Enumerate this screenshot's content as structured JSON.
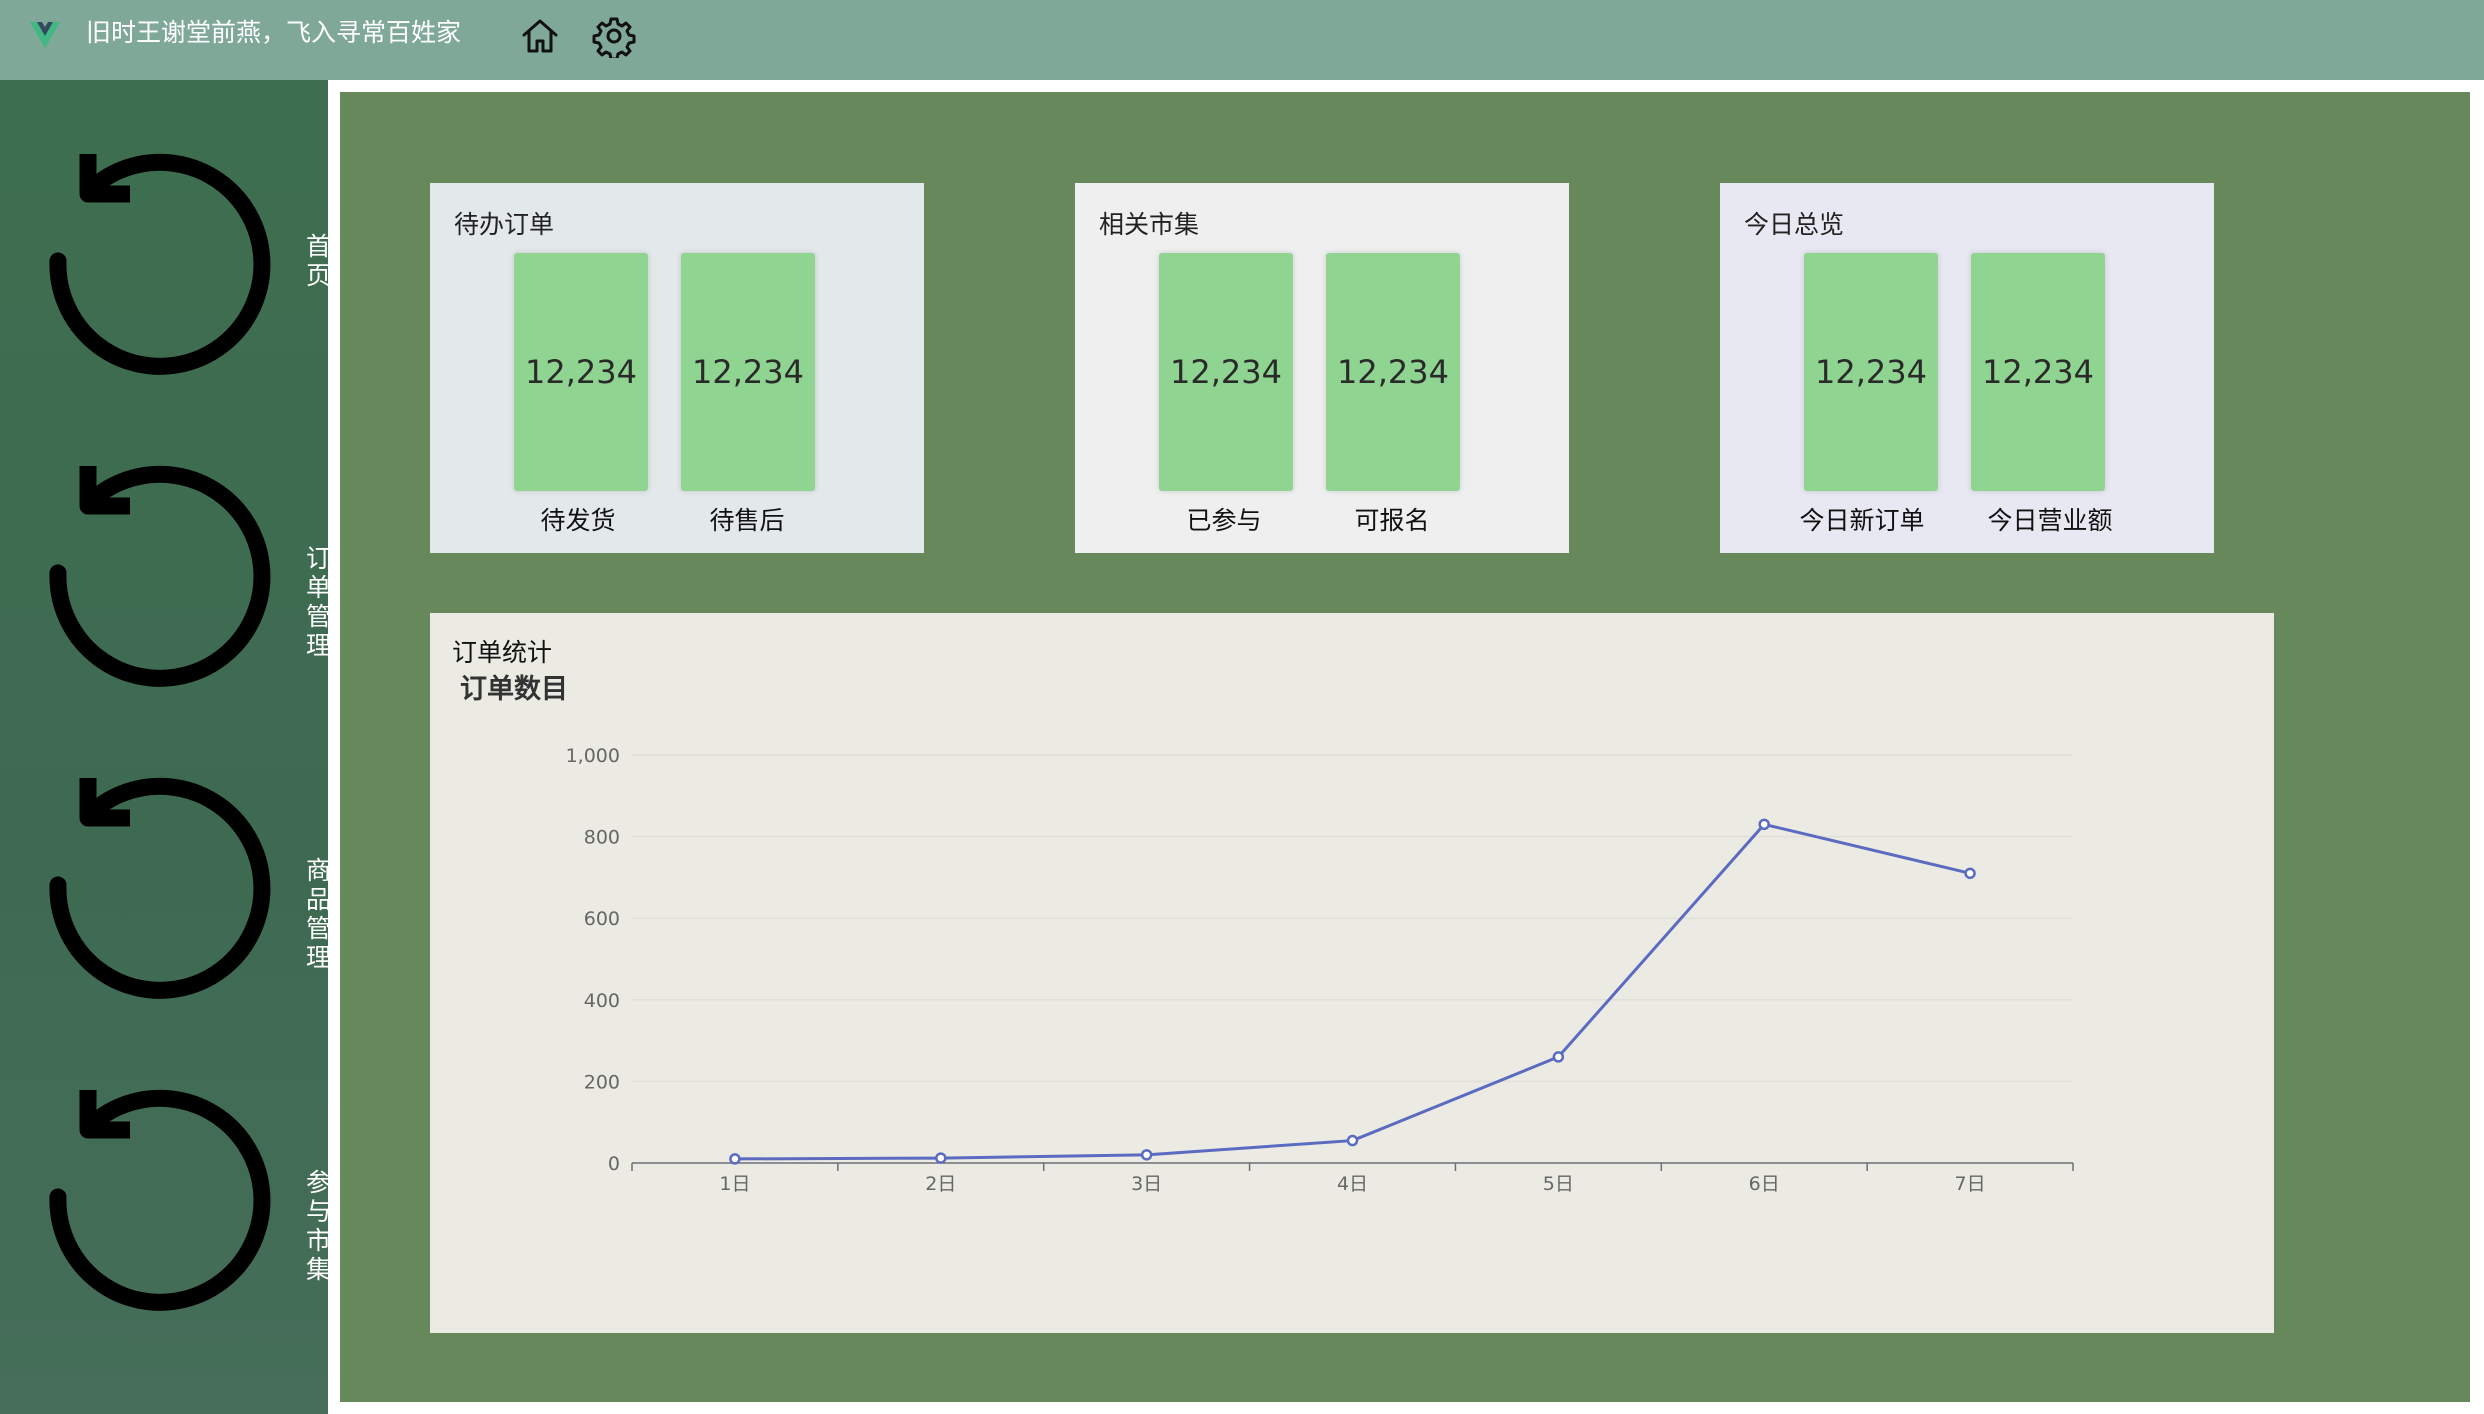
{
  "header": {
    "title": "旧时王谢堂前燕，飞入寻常百姓家",
    "logo_icon": "vue-logo-icon",
    "home_icon": "home-icon",
    "settings_icon": "gear-icon",
    "background": "#7fa898"
  },
  "sidebar": {
    "items": [
      {
        "label": "首页",
        "icon": "refresh-icon"
      },
      {
        "label": "订单管理",
        "icon": "refresh-icon"
      },
      {
        "label": "商品管理",
        "icon": "refresh-icon"
      },
      {
        "label": "参与市集",
        "icon": "refresh-icon"
      }
    ]
  },
  "cards": [
    {
      "title": "待办订单",
      "background": "#e3e8ea",
      "stats": [
        {
          "value": "12,234",
          "label": "待发货"
        },
        {
          "value": "12,234",
          "label": "待售后"
        }
      ]
    },
    {
      "title": "相关市集",
      "background": "#efefef",
      "stats": [
        {
          "value": "12,234",
          "label": "已参与"
        },
        {
          "value": "12,234",
          "label": "可报名"
        }
      ]
    },
    {
      "title": "今日总览",
      "background": "#e8e8f2",
      "stats": [
        {
          "value": "12,234",
          "label": "今日新订单"
        },
        {
          "value": "12,234",
          "label": "今日营业额"
        }
      ]
    }
  ],
  "chart_panel": {
    "title": "订单统计"
  },
  "chart_data": {
    "type": "line",
    "title": "订单数目",
    "categories": [
      "1日",
      "2日",
      "3日",
      "4日",
      "5日",
      "6日",
      "7日"
    ],
    "series": [
      {
        "values": [
          10,
          12,
          20,
          55,
          260,
          830,
          710
        ],
        "color": "#5b6bc0"
      }
    ],
    "ylim": [
      0,
      1000
    ],
    "yticks": [
      "0",
      "200",
      "400",
      "600",
      "800",
      "1,000"
    ],
    "grid": true
  }
}
